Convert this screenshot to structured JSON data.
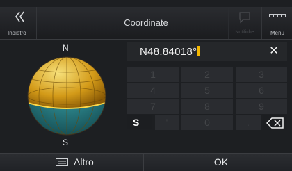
{
  "header": {
    "back_label": "Indietro",
    "title": "Coordinate",
    "notifications_label": "Notifiche",
    "menu_label": "Menu"
  },
  "compass": {
    "north": "N",
    "south": "S"
  },
  "input": {
    "value": "N48.84018°",
    "clear_symbol": "✕"
  },
  "keypad": {
    "keys": [
      "1",
      "2",
      "3",
      "4",
      "5",
      "6",
      "7",
      "8",
      "9",
      "S",
      "'",
      "0",
      ".",
      "⌫"
    ],
    "active": [
      "S",
      "⌫"
    ]
  },
  "footer": {
    "more_label": "Altro",
    "ok_label": "OK"
  },
  "colors": {
    "accent": "#f5b800",
    "globe_gold": "#d9a41c",
    "globe_teal": "#2a7f86"
  }
}
